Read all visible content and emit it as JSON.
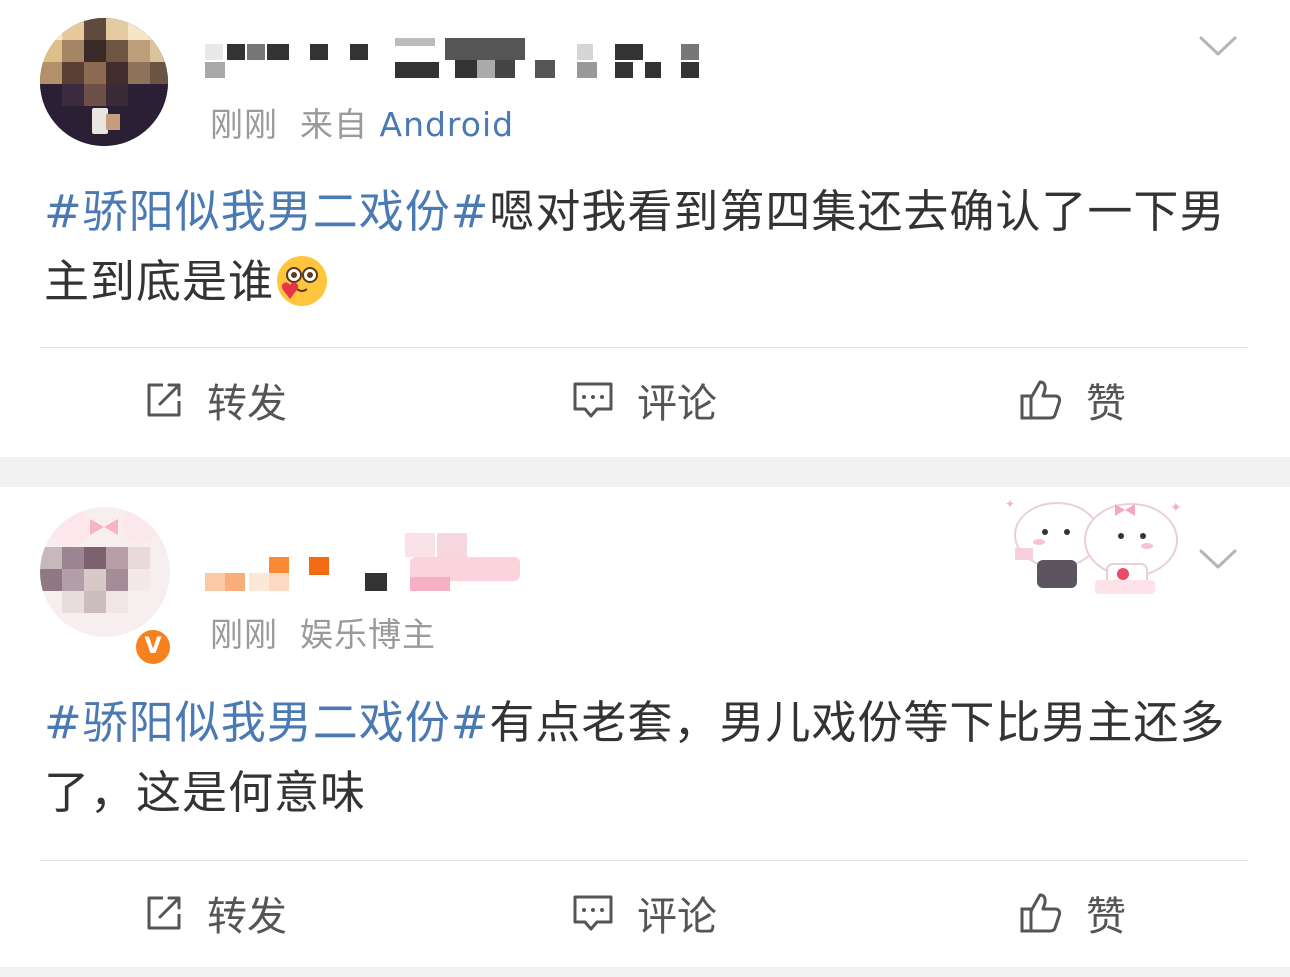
{
  "posts": [
    {
      "time": "刚刚",
      "source": "来自",
      "source_app": "Android",
      "topic": "#骄阳似我男二戏份#",
      "text": "嗯对我看到第四集还去确认了一下男主到底是谁",
      "emoji": "love-face-emoji",
      "actions": {
        "repost": "转发",
        "comment": "评论",
        "like": "赞"
      }
    },
    {
      "time": "刚刚",
      "source": "娱乐博主",
      "verified_badge": "V",
      "topic": "#骄阳似我男二戏份#",
      "text": "有点老套，男儿戏份等下比男主还多了，这是何意味",
      "actions": {
        "repost": "转发",
        "comment": "评论",
        "like": "赞"
      }
    }
  ],
  "colors": {
    "topic": "#4a79b3",
    "meta": "#9a9a9a",
    "badge": "#f7811f",
    "separator": "#f2f2f2"
  }
}
